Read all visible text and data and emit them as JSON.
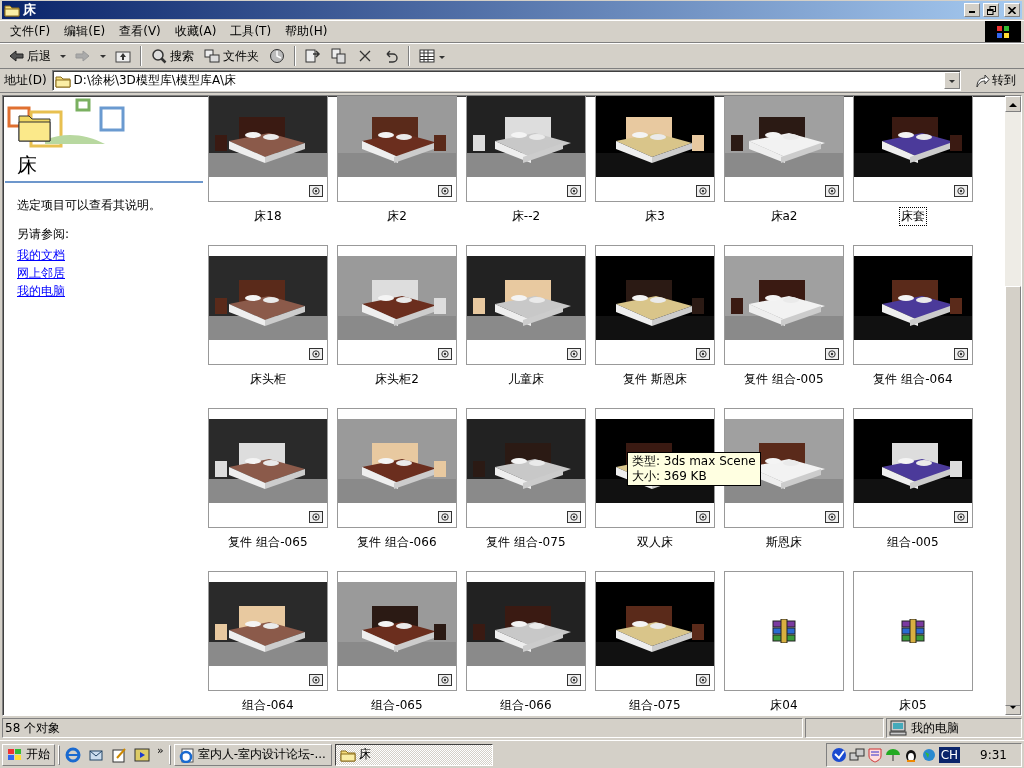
{
  "window": {
    "title": "床"
  },
  "menu": [
    {
      "label": "文件(F)"
    },
    {
      "label": "编辑(E)"
    },
    {
      "label": "查看(V)"
    },
    {
      "label": "收藏(A)"
    },
    {
      "label": "工具(T)"
    },
    {
      "label": "帮助(H)"
    }
  ],
  "toolbar": [
    {
      "kind": "back",
      "label": "后退"
    },
    {
      "kind": "dropdown"
    },
    {
      "kind": "forward"
    },
    {
      "kind": "dropdown"
    },
    {
      "kind": "up"
    },
    {
      "kind": "separator"
    },
    {
      "kind": "search",
      "label": "搜索"
    },
    {
      "kind": "folders",
      "label": "文件夹"
    },
    {
      "kind": "history"
    },
    {
      "kind": "separator"
    },
    {
      "kind": "move"
    },
    {
      "kind": "copy"
    },
    {
      "kind": "delete"
    },
    {
      "kind": "undo"
    },
    {
      "kind": "separator"
    },
    {
      "kind": "views"
    }
  ],
  "address": {
    "label": "地址(D)",
    "value": "D:\\徐彬\\3D模型库\\模型库A\\床",
    "go": "转到"
  },
  "sidebar": {
    "title": "床",
    "description": "选定项目可以查看其说明。",
    "see_also": "另请参阅:",
    "links": [
      "我的文档",
      "网上邻居",
      "我的电脑"
    ]
  },
  "items": [
    {
      "label": "床18",
      "kind": "render",
      "focused": false
    },
    {
      "label": "床2",
      "kind": "render",
      "focused": false
    },
    {
      "label": "床--2",
      "kind": "render",
      "focused": false
    },
    {
      "label": "床3",
      "kind": "render",
      "focused": false
    },
    {
      "label": "床a2",
      "kind": "render",
      "focused": false
    },
    {
      "label": "床套",
      "kind": "render",
      "focused": true
    },
    {
      "label": "床头柜",
      "kind": "render",
      "focused": false
    },
    {
      "label": "床头柜2",
      "kind": "render",
      "focused": false
    },
    {
      "label": "儿童床",
      "kind": "render",
      "focused": false
    },
    {
      "label": "复件 斯恩床",
      "kind": "render",
      "focused": false
    },
    {
      "label": "复件 组合-005",
      "kind": "render",
      "focused": false
    },
    {
      "label": "复件 组合-064",
      "kind": "render",
      "focused": false
    },
    {
      "label": "复件 组合-065",
      "kind": "render",
      "focused": false
    },
    {
      "label": "复件 组合-066",
      "kind": "render",
      "focused": false
    },
    {
      "label": "复件 组合-075",
      "kind": "render",
      "focused": false
    },
    {
      "label": "双人床",
      "kind": "render",
      "focused": false
    },
    {
      "label": "斯恩床",
      "kind": "render",
      "focused": false
    },
    {
      "label": "组合-005",
      "kind": "render",
      "focused": false
    },
    {
      "label": "组合-064",
      "kind": "render",
      "focused": false
    },
    {
      "label": "组合-065",
      "kind": "render",
      "focused": false
    },
    {
      "label": "组合-066",
      "kind": "render",
      "focused": false
    },
    {
      "label": "组合-075",
      "kind": "render",
      "focused": false
    },
    {
      "label": "床04",
      "kind": "archive",
      "focused": false
    },
    {
      "label": "床05",
      "kind": "archive",
      "focused": false
    }
  ],
  "tooltip": {
    "lines": [
      "类型: 3ds max Scene",
      "大小: 369 KB"
    ]
  },
  "status_bar": {
    "count": "58 个对象",
    "zone": "我的电脑"
  },
  "taskbar": {
    "start": "开始",
    "chevron": "»",
    "tasks": [
      {
        "label": "室内人-室内设计论坛-...",
        "selected": false
      },
      {
        "label": "床",
        "selected": true
      }
    ],
    "ime": "CH",
    "clock": "9:31"
  }
}
